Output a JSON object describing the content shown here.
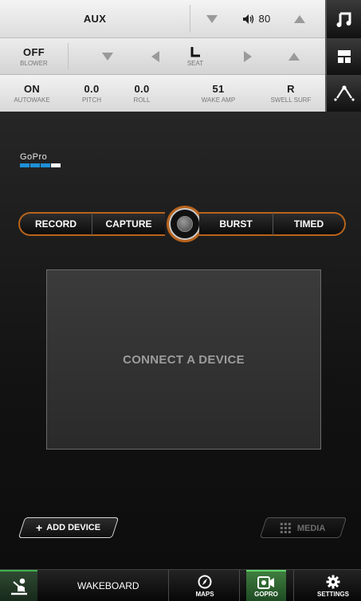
{
  "top_panel": {
    "row1": {
      "source_label": "AUX",
      "volume_value": "80",
      "volume_icon": "speaker-icon",
      "side_icon": "music-note-icon"
    },
    "row2": {
      "blower_value": "OFF",
      "blower_label": "BLOWER",
      "seat_label": "SEAT",
      "seat_icon": "seat-icon",
      "side_icon": "layout-icon"
    },
    "row3": {
      "autowake_value": "ON",
      "autowake_label": "AUTOWAKE",
      "pitch_value": "0.0",
      "pitch_label": "PITCH",
      "roll_value": "0.0",
      "roll_label": "ROLL",
      "wake_amp_value": "51",
      "wake_amp_label": "WAKE AMP",
      "swell_surf_value": "R",
      "swell_surf_label": "SWELL SURF",
      "side_icon": "wake-shape-icon"
    }
  },
  "gopro": {
    "logo_text": "GoPro",
    "modes": [
      "RECORD",
      "CAPTURE",
      "BURST",
      "TIMED"
    ],
    "preview_message": "CONNECT A DEVICE",
    "add_device_label": "ADD DEVICE",
    "media_label": "MEDIA"
  },
  "nav": {
    "activity_label": "WAKEBOARD",
    "items": [
      {
        "label": "MAPS",
        "icon": "compass-icon"
      },
      {
        "label": "GOPRO",
        "icon": "camera-icon"
      },
      {
        "label": "SETTINGS",
        "icon": "gear-icon"
      }
    ]
  },
  "colors": {
    "accent_orange": "#b8641d",
    "active_green": "#5fd36c",
    "gopro_blue": "#1e90d6",
    "panel_light": "#e6e6e6"
  }
}
